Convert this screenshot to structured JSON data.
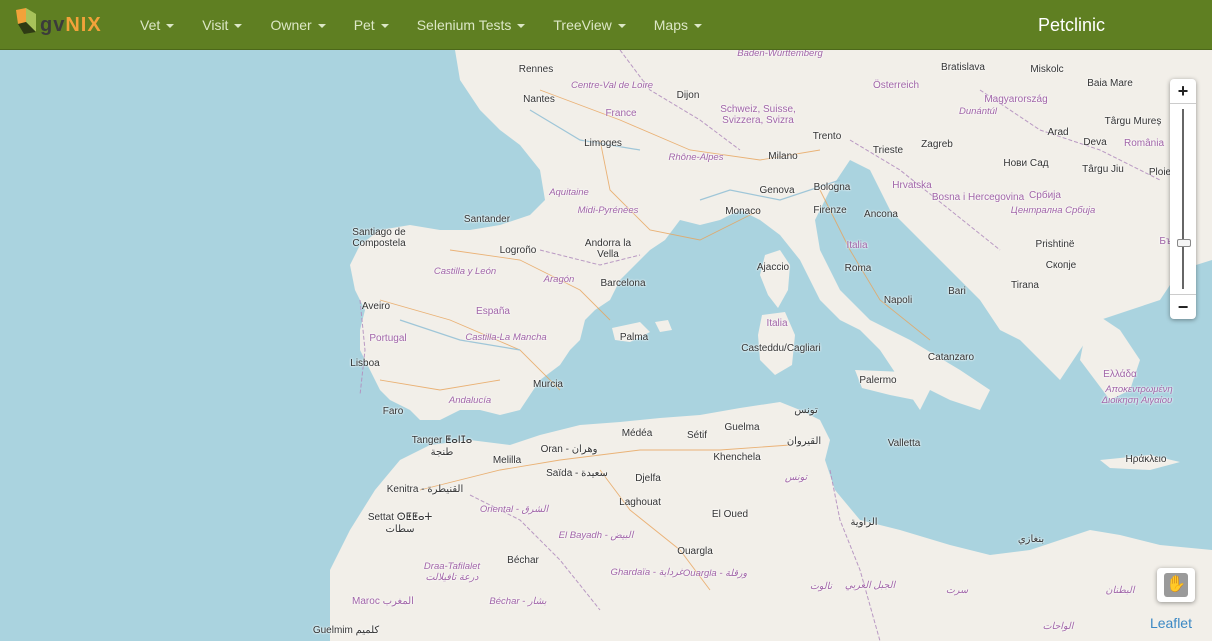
{
  "header": {
    "logo_text_1": "gv",
    "logo_text_2": "NIX",
    "menu": [
      {
        "label": "Vet"
      },
      {
        "label": "Visit"
      },
      {
        "label": "Owner"
      },
      {
        "label": "Pet"
      },
      {
        "label": "Selenium Tests"
      },
      {
        "label": "TreeView"
      },
      {
        "label": "Maps"
      }
    ],
    "brand": "Petclinic"
  },
  "map": {
    "zoom_in": "+",
    "zoom_out": "−",
    "attribution": "Leaflet",
    "labels": {
      "baden": "Baden-Württemberg",
      "rennes": "Rennes",
      "nantes": "Nantes",
      "centre": "Centre-Val de Loire",
      "dijon": "Dijon",
      "france": "France",
      "schweiz": "Schweiz, Suisse, Svizzera, Svizra",
      "bratislava": "Bratislava",
      "miskolc": "Miskolc",
      "baia_mare": "Baia Mare",
      "osterreich": "Österreich",
      "magyarorszag": "Magyarország",
      "dunantul": "Dunántúl",
      "targu_mures": "Târgu Mureș",
      "limoges": "Limoges",
      "trento": "Trento",
      "rhone": "Rhône-Alpes",
      "milano": "Milano",
      "trieste": "Trieste",
      "zagreb": "Zagreb",
      "arad": "Arad",
      "deva": "Deva",
      "romania": "România",
      "novi_sad": "Нови Сад",
      "targu_jiu": "Târgu Jiu",
      "ploiesti": "Ploie",
      "aquitaine": "Aquitaine",
      "genova": "Genova",
      "bologna": "Bologna",
      "hrvatska": "Hrvatska",
      "bosna": "Bosna i Hercegovina",
      "srbija": "Србија",
      "midi": "Midi-Pyrénées",
      "monaco": "Monaco",
      "firenze": "Firenze",
      "ancona": "Ancona",
      "centralna": "Централна Србија",
      "santander": "Santander",
      "santiago": "Santiago de Compostela",
      "logrono": "Logroño",
      "andorra": "Andorra la Vella",
      "italia": "Italia",
      "prishtine": "Prishtinë",
      "bulgaria": "Българ",
      "castilla": "Castilla y León",
      "ajaccio": "Ajaccio",
      "roma": "Roma",
      "skopje": "Скопје",
      "aragon": "Aragón",
      "barcelona": "Barcelona",
      "bari": "Bari",
      "tirana": "Tirana",
      "aveiro": "Aveiro",
      "espana": "España",
      "napoli": "Napoli",
      "portugal": "Portugal",
      "castilla_mancha": "Castilla-La Mancha",
      "palma": "Palma",
      "italia2": "Italia",
      "cagliari": "Casteddu/Cagliari",
      "lisboa": "Lisboa",
      "catanzaro": "Catanzaro",
      "ellada": "Ελλάδα",
      "murcia": "Murcia",
      "palermo": "Palermo",
      "apokentr": "Αποκεντρωμένη",
      "dioikisi": "Διοίκηση Αιγαίου",
      "andalucia": "Andalucía",
      "faro": "Faro",
      "tunis": "تونس",
      "tanger": "Tanger ⵟⴰⵏⵊⴰ",
      "tanja": "طنجة",
      "medea": "Médéa",
      "setif": "Sétif",
      "guelma": "Guelma",
      "qairawan": "القيروان",
      "valletta": "Valletta",
      "oran": "Oran - وهران",
      "melilla": "Melilla",
      "khenchela": "Khenchela",
      "iraklio": "Ηράκλειο",
      "saida": "Saïda - سعيدة",
      "djelfa": "Djelfa",
      "tunis2": "تونس",
      "kenitra": "Kenitra - القنيطرة",
      "laghouat": "Laghouat",
      "oriental": "Oriental - الشرق",
      "el_oued": "El Oued",
      "zawiya": "الزاوية",
      "settat": "Settat ⵙⵟⵟⴰⵜ",
      "settat_ar": "سطات",
      "el_bayadh": "El Bayadh - البيض",
      "benghazi": "بنغازي",
      "ouargla": "Ouargla",
      "draa": "Draa-Tafilalet",
      "draa_ar": "درعة تافيلالت",
      "bechar": "Béchar",
      "ghardaia": "Ghardaïa - غرداية",
      "ouargla2": "Ouargla - ورقلة",
      "nalut": "نالوت",
      "jabal": "الجبل الغربي",
      "sirt": "سرت",
      "butnan": "البطنان",
      "maroc": "Maroc المغرب",
      "bechar2": "Béchar - بشار",
      "guelmim": "Guelmim كلميم",
      "wahat": "الواحات"
    }
  }
}
